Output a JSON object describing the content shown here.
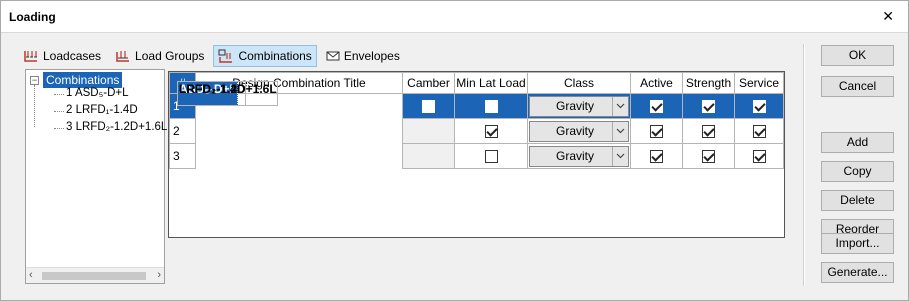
{
  "window": {
    "title": "Loading",
    "close_glyph": "✕"
  },
  "tabs": [
    {
      "label": "Loadcases",
      "icon": "loadcases-icon"
    },
    {
      "label": "Load Groups",
      "icon": "load-groups-icon"
    },
    {
      "label": "Combinations",
      "icon": "combinations-icon",
      "active": true
    },
    {
      "label": "Envelopes",
      "icon": "envelope-icon"
    }
  ],
  "tree": {
    "root": "Combinations",
    "toggle": "−",
    "items": [
      "1 ASD₅-D+L",
      "2 LRFD₁-1.4D",
      "3 LRFD₂-1.2D+1.6L"
    ],
    "scroll_left": "‹",
    "scroll_right": "›"
  },
  "grid": {
    "columns": [
      "#",
      "Design Combination Title",
      "Camber",
      "Min Lat Load",
      "Class",
      "Active",
      "Strength",
      "Service"
    ],
    "rows": [
      {
        "num": "1",
        "title": "ASD₅-D+L",
        "camber": false,
        "min_lat": false,
        "class": "Gravity",
        "active": true,
        "strength": true,
        "service": true
      },
      {
        "num": "2",
        "title": "LRFD₁-1.4D",
        "camber": null,
        "min_lat": true,
        "class": "Gravity",
        "active": true,
        "strength": true,
        "service": true
      },
      {
        "num": "3",
        "title": "LRFD₂-1.2D+1.6L",
        "camber": null,
        "min_lat": false,
        "class": "Gravity",
        "active": true,
        "strength": true,
        "service": true
      }
    ]
  },
  "buttons": {
    "ok": "OK",
    "cancel": "Cancel",
    "add": "Add",
    "copy": "Copy",
    "delete": "Delete",
    "reorder": "Reorder",
    "import": "Import...",
    "generate": "Generate..."
  },
  "colors": {
    "selection": "#1c64b6",
    "tab_active_bg": "#cde6f7"
  }
}
